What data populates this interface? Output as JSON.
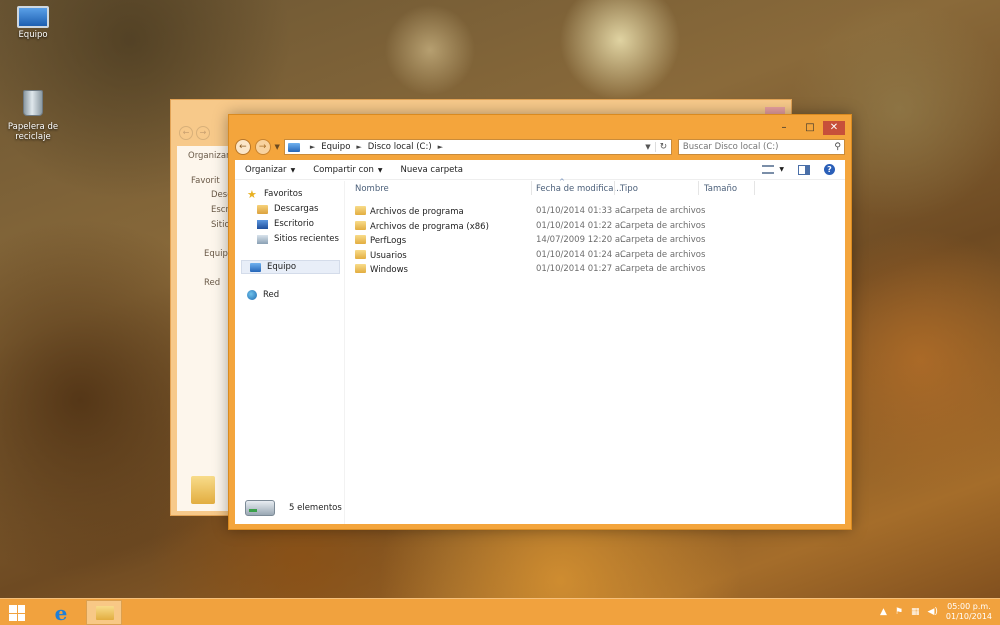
{
  "desktop": {
    "icons": [
      {
        "label": "Equipo"
      },
      {
        "label": "Papelera de reciclaje"
      }
    ]
  },
  "back_window": {
    "toolbar_label": "Organizar",
    "nav": [
      "Favorit",
      "Desca",
      "Escri",
      "Sitio",
      "Equipo",
      "Red"
    ]
  },
  "window": {
    "controls": {
      "minimize": "–",
      "maximize": "□",
      "close": "✕"
    },
    "address": {
      "crumbs": [
        "Equipo",
        "Disco local (C:)"
      ]
    },
    "search": {
      "placeholder": "Buscar Disco local (C:)"
    },
    "toolbar": {
      "organize": "Organizar",
      "share": "Compartir con",
      "new_folder": "Nueva carpeta"
    },
    "nav": {
      "favorites": "Favoritos",
      "downloads": "Descargas",
      "desktop": "Escritorio",
      "recent": "Sitios recientes",
      "computer": "Equipo",
      "network": "Red"
    },
    "columns": {
      "name": "Nombre",
      "date": "Fecha de modifica...",
      "type": "Tipo",
      "size": "Tamaño"
    },
    "files": [
      {
        "name": "Archivos de programa",
        "date": "01/10/2014 01:33 a...",
        "type": "Carpeta de archivos",
        "size": ""
      },
      {
        "name": "Archivos de programa (x86)",
        "date": "01/10/2014 01:22 a...",
        "type": "Carpeta de archivos",
        "size": ""
      },
      {
        "name": "PerfLogs",
        "date": "14/07/2009 12:20 a...",
        "type": "Carpeta de archivos",
        "size": ""
      },
      {
        "name": "Usuarios",
        "date": "01/10/2014 01:24 a...",
        "type": "Carpeta de archivos",
        "size": ""
      },
      {
        "name": "Windows",
        "date": "01/10/2014 01:27 a...",
        "type": "Carpeta de archivos",
        "size": ""
      }
    ],
    "status": {
      "count": "5 elementos"
    }
  },
  "taskbar": {
    "clock": {
      "time": "05:00 p.m.",
      "date": "01/10/2014"
    }
  },
  "colors": {
    "accent": "#f4a53c",
    "taskbar": "#f1a23e",
    "close_button": "#c7503a"
  }
}
